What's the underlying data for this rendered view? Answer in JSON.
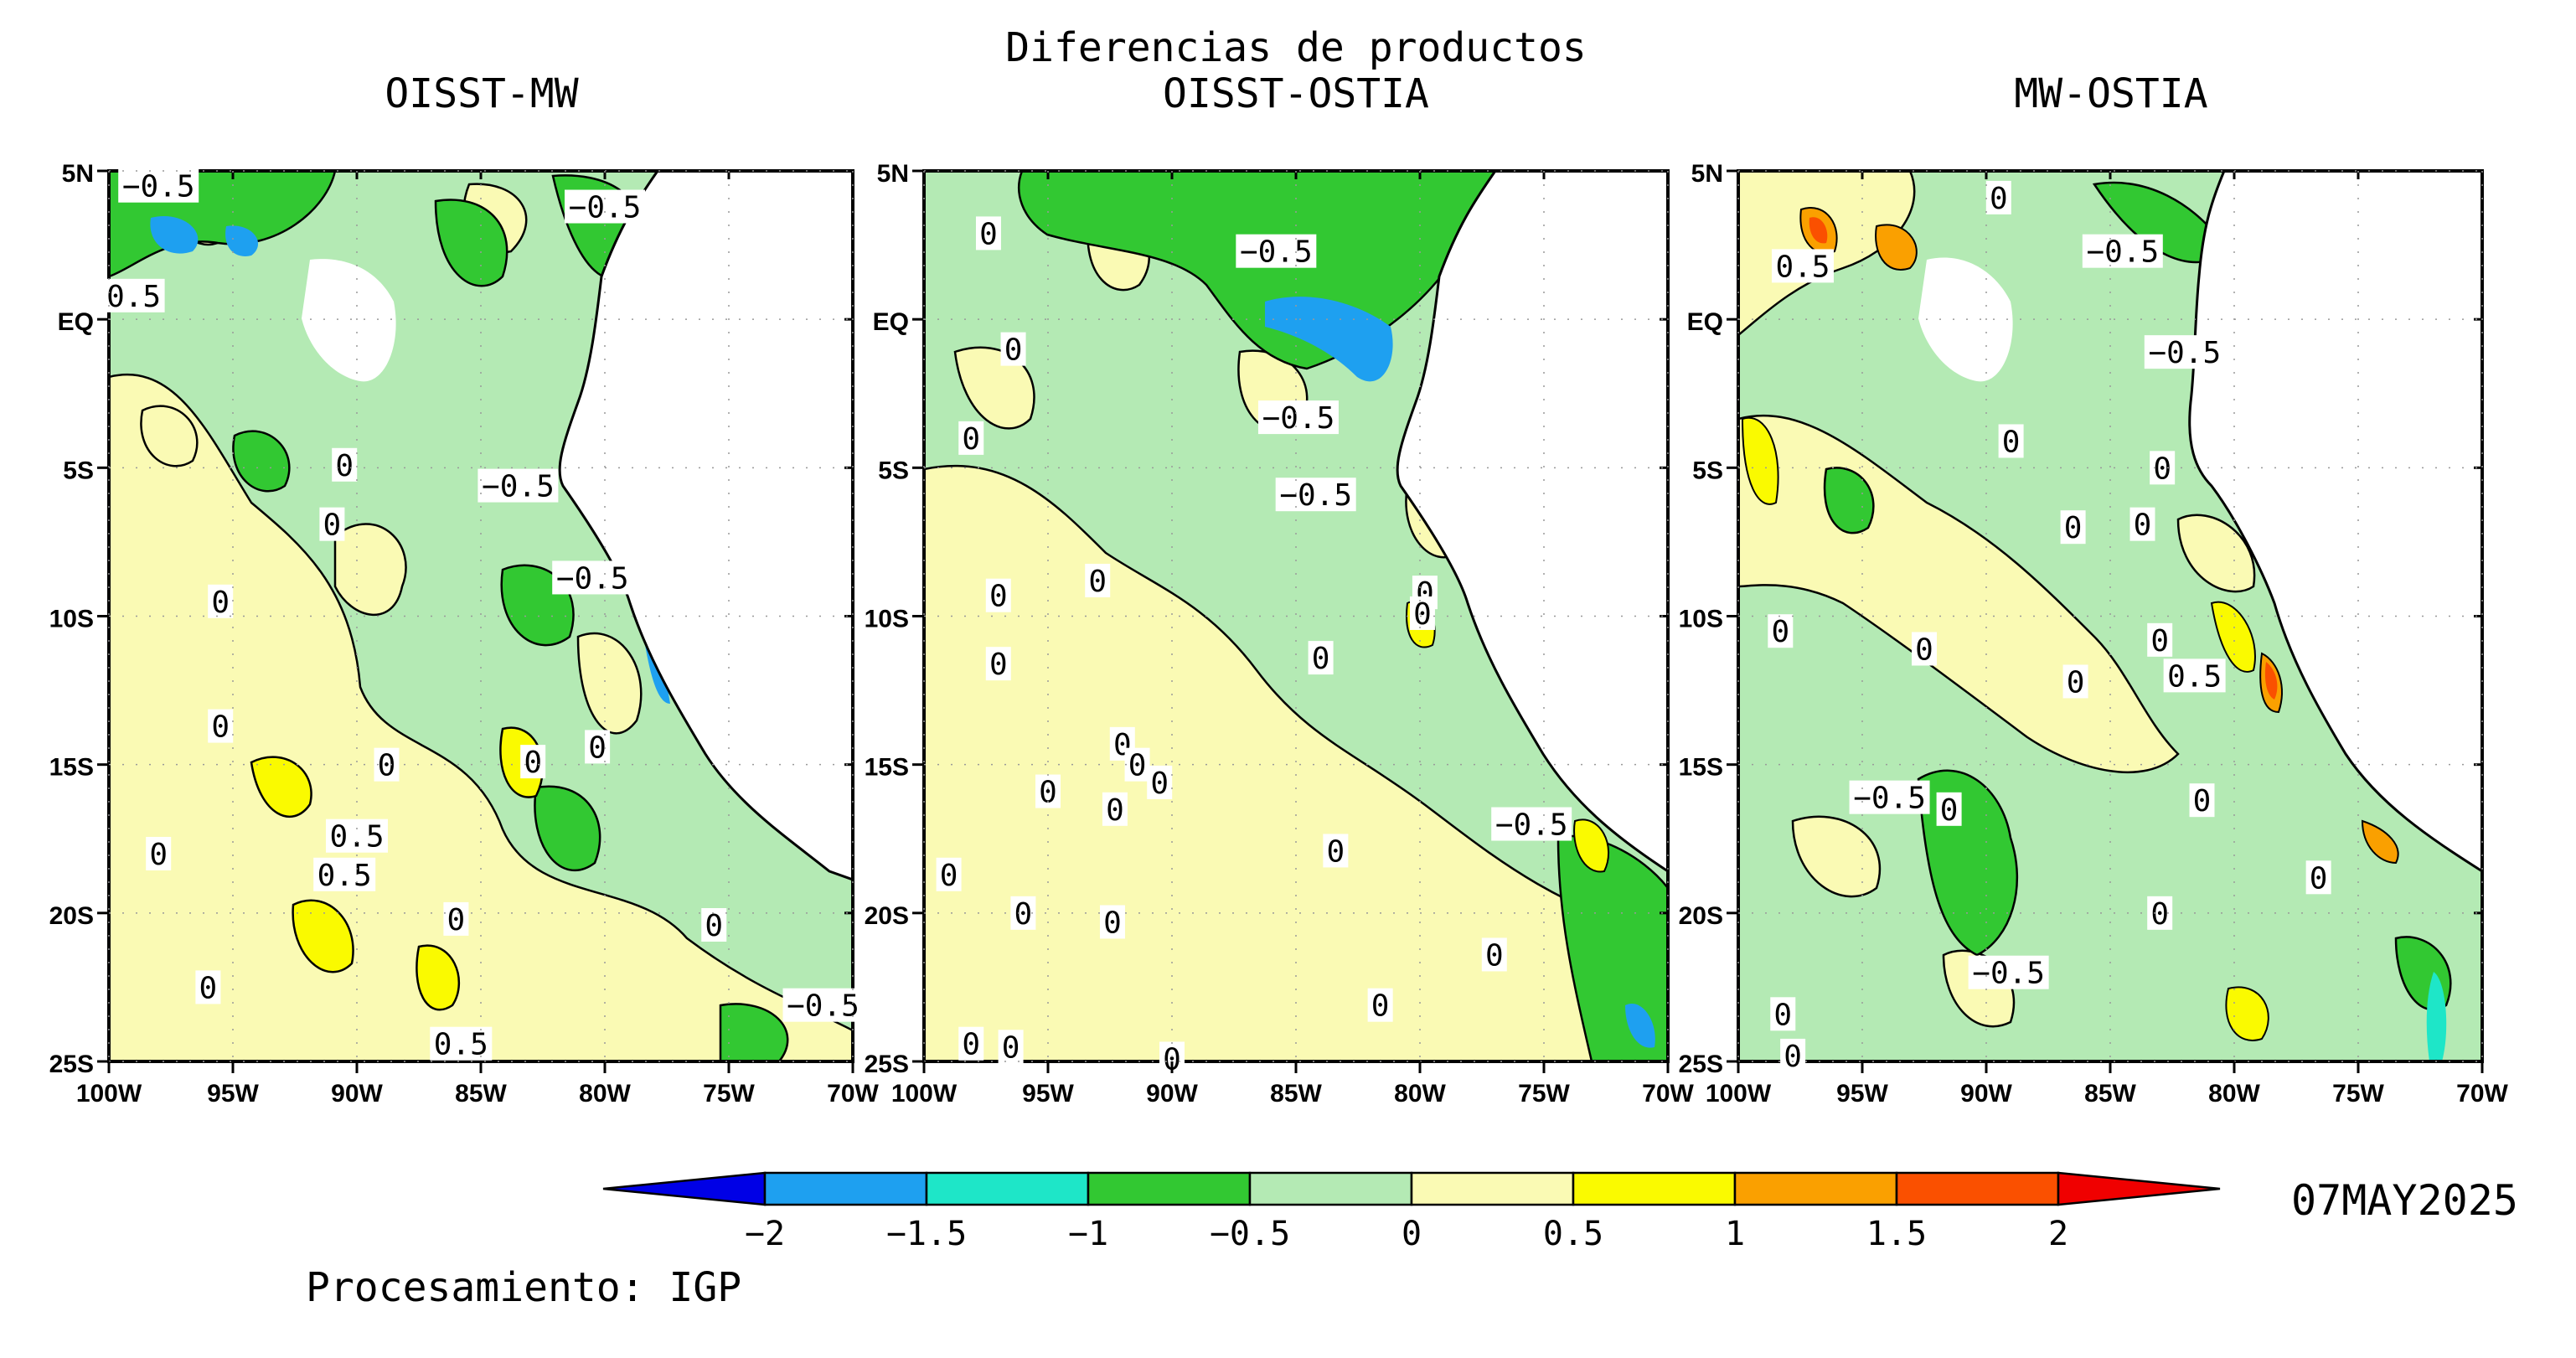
{
  "figure": {
    "main_title": "Diferencias de productos",
    "credit": "Procesamiento: IGP",
    "date": "07MAY2025"
  },
  "axes": {
    "lat_labels": [
      "5N",
      "EQ",
      "5S",
      "10S",
      "15S",
      "20S",
      "25S"
    ],
    "lon_labels": [
      "100W",
      "95W",
      "90W",
      "85W",
      "80W",
      "75W",
      "70W"
    ]
  },
  "panels": [
    {
      "title": "OISST-MW",
      "contour_labels": [
        {
          "text": "-0.5",
          "lon": -98,
          "lat": 4.5
        },
        {
          "text": "-0.5",
          "lon": -80,
          "lat": 3.8
        },
        {
          "text": "0.5",
          "lon": -99,
          "lat": 0.8
        },
        {
          "text": "0",
          "lon": -90.5,
          "lat": -4.9
        },
        {
          "text": "-0.5",
          "lon": -83.5,
          "lat": -5.6
        },
        {
          "text": "0",
          "lon": -91,
          "lat": -6.9
        },
        {
          "text": "-0.5",
          "lon": -80.5,
          "lat": -8.7
        },
        {
          "text": "0",
          "lon": -95.5,
          "lat": -9.5
        },
        {
          "text": "0",
          "lon": -95.5,
          "lat": -13.7
        },
        {
          "text": "0",
          "lon": -88.8,
          "lat": -15.0
        },
        {
          "text": "0",
          "lon": -82.9,
          "lat": -14.9
        },
        {
          "text": "0",
          "lon": -80.3,
          "lat": -14.4
        },
        {
          "text": "0.5",
          "lon": -90,
          "lat": -17.4
        },
        {
          "text": "0",
          "lon": -98,
          "lat": -18.0
        },
        {
          "text": "0.5",
          "lon": -90.5,
          "lat": -18.7
        },
        {
          "text": "0",
          "lon": -86,
          "lat": -20.2
        },
        {
          "text": "0",
          "lon": -75.6,
          "lat": -20.4
        },
        {
          "text": "0",
          "lon": -96,
          "lat": -22.5
        },
        {
          "text": "-0.5",
          "lon": -71.2,
          "lat": -23.1
        },
        {
          "text": "0.5",
          "lon": -85.8,
          "lat": -24.4
        }
      ]
    },
    {
      "title": "OISST-OSTIA",
      "contour_labels": [
        {
          "text": "0",
          "lon": -97.4,
          "lat": 2.9
        },
        {
          "text": "-0.5",
          "lon": -85.8,
          "lat": 2.3
        },
        {
          "text": "0",
          "lon": -96.4,
          "lat": -1.0
        },
        {
          "text": "-0.5",
          "lon": -84.9,
          "lat": -3.3
        },
        {
          "text": "0",
          "lon": -98.1,
          "lat": -4.0
        },
        {
          "text": "-0.5",
          "lon": -84.2,
          "lat": -5.9
        },
        {
          "text": "0",
          "lon": -93,
          "lat": -8.8
        },
        {
          "text": "0",
          "lon": -97,
          "lat": -9.3
        },
        {
          "text": "0",
          "lon": -79.8,
          "lat": -9.2
        },
        {
          "text": "0",
          "lon": -79.9,
          "lat": -9.9
        },
        {
          "text": "0",
          "lon": -97,
          "lat": -11.6
        },
        {
          "text": "0",
          "lon": -84,
          "lat": -11.4
        },
        {
          "text": "0",
          "lon": -92,
          "lat": -14.3
        },
        {
          "text": "0",
          "lon": -91.4,
          "lat": -15.0
        },
        {
          "text": "0",
          "lon": -95,
          "lat": -15.9
        },
        {
          "text": "0",
          "lon": -90.5,
          "lat": -15.6
        },
        {
          "text": "0",
          "lon": -92.3,
          "lat": -16.5
        },
        {
          "text": "-0.5",
          "lon": -75.5,
          "lat": -17.0
        },
        {
          "text": "0",
          "lon": -83.4,
          "lat": -17.9
        },
        {
          "text": "0",
          "lon": -99,
          "lat": -18.7
        },
        {
          "text": "0",
          "lon": -96,
          "lat": -20.0
        },
        {
          "text": "0",
          "lon": -92.4,
          "lat": -20.3
        },
        {
          "text": "0",
          "lon": -77,
          "lat": -21.4
        },
        {
          "text": "0",
          "lon": -81.6,
          "lat": -23.1
        },
        {
          "text": "0",
          "lon": -98.1,
          "lat": -24.4
        },
        {
          "text": "0",
          "lon": -96.5,
          "lat": -24.5
        },
        {
          "text": "0",
          "lon": -90,
          "lat": -24.9
        }
      ]
    },
    {
      "title": "MW-OSTIA",
      "contour_labels": [
        {
          "text": "0",
          "lon": -89.5,
          "lat": 4.1
        },
        {
          "text": "0.5",
          "lon": -97.4,
          "lat": 1.8
        },
        {
          "text": "-0.5",
          "lon": -84.5,
          "lat": 2.3
        },
        {
          "text": "-0.5",
          "lon": -82,
          "lat": -1.1
        },
        {
          "text": "0",
          "lon": -89,
          "lat": -4.1
        },
        {
          "text": "0",
          "lon": -82.9,
          "lat": -5.0
        },
        {
          "text": "0",
          "lon": -86.5,
          "lat": -7.0
        },
        {
          "text": "0",
          "lon": -83.7,
          "lat": -6.9
        },
        {
          "text": "0",
          "lon": -98.3,
          "lat": -10.5
        },
        {
          "text": "0",
          "lon": -92.5,
          "lat": -11.1
        },
        {
          "text": "0",
          "lon": -83,
          "lat": -10.8
        },
        {
          "text": "0",
          "lon": -86.4,
          "lat": -12.2
        },
        {
          "text": "0.5",
          "lon": -81.6,
          "lat": -12.0
        },
        {
          "text": "-0.5",
          "lon": -93.9,
          "lat": -16.1
        },
        {
          "text": "0",
          "lon": -91.5,
          "lat": -16.5
        },
        {
          "text": "0",
          "lon": -81.3,
          "lat": -16.2
        },
        {
          "text": "0",
          "lon": -76.6,
          "lat": -18.8
        },
        {
          "text": "0",
          "lon": -83,
          "lat": -20.0
        },
        {
          "text": "-0.5",
          "lon": -89.1,
          "lat": -22.0
        },
        {
          "text": "0",
          "lon": -98.2,
          "lat": -23.4
        },
        {
          "text": "0",
          "lon": -97.8,
          "lat": -24.8
        }
      ]
    }
  ],
  "colorbar": {
    "ticks": [
      "-2",
      "-1.5",
      "-1",
      "-0.5",
      "0",
      "0.5",
      "1",
      "1.5",
      "2"
    ],
    "colors": [
      "#0000e6",
      "#1ea0f0",
      "#1ee6c8",
      "#32c832",
      "#b4eab4",
      "#fafab4",
      "#fafa00",
      "#faa000",
      "#fa5000",
      "#f00000"
    ]
  }
}
